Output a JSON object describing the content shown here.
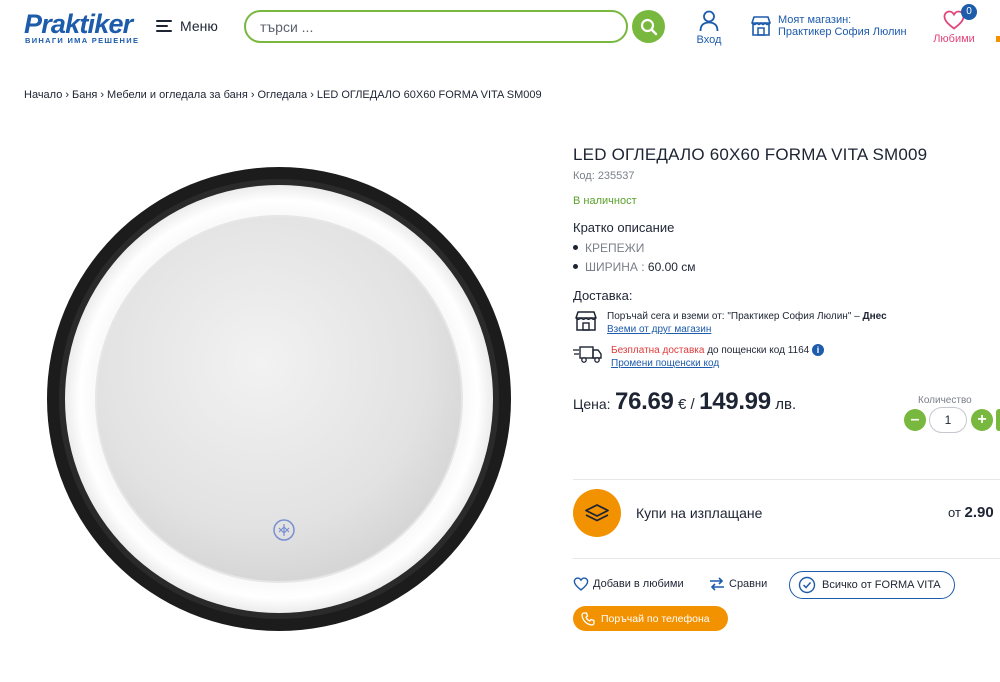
{
  "header": {
    "logo_text": "Praktiker",
    "logo_tagline": "ВИНАГИ ИМА РЕШЕНИЕ",
    "menu_label": "Меню",
    "search_placeholder": "търси ...",
    "login_label": "Вход",
    "store_label": "Моят магазин:",
    "store_name": "Практикер София Люлин",
    "favorites_label": "Любими",
    "favorites_count": "0"
  },
  "breadcrumb": [
    "Начало",
    "Баня",
    "Мебели и огледала за баня",
    "Огледала",
    "LED ОГЛЕДАЛО 60X60 FORMA VITA SM009"
  ],
  "product": {
    "title": "LED ОГЛЕДАЛО 60X60 FORMA VITA SM009",
    "sku": "Код: 235537",
    "stock": "В наличност",
    "short_description_title": "Кратко описание",
    "specs": [
      {
        "key": "КРЕПЕЖИ",
        "value": ""
      },
      {
        "key": "ШИРИНА :",
        "value": " 60.00 см"
      }
    ]
  },
  "delivery": {
    "title": "Доставка:",
    "pickup_text": "Поръчай сега и вземи от: \"Практикер София Люлин\" – ",
    "pickup_when": "Днес",
    "pickup_link": "Вземи от друг магазин",
    "free_label": "Безплатна доставка",
    "free_text": " до пощенски код 1164",
    "postcode_link": "Промени пощенски код"
  },
  "price": {
    "label": "Цена:",
    "eur": "76.69",
    "eur_sym": "€ /",
    "bgn": "149.99",
    "bgn_sym": "лв."
  },
  "quantity": {
    "label": "Количество",
    "value": "1",
    "minus": "–",
    "plus": "+"
  },
  "installment": {
    "label": "Купи на изплащане",
    "from_prefix": "от",
    "from_value": "2.90"
  },
  "actions": {
    "favorite": "Добави в любими",
    "compare": "Сравни",
    "brand": "Всичко от FORMA VITA",
    "phone_order": "Поръчай по телефона"
  },
  "colors": {
    "brand_blue": "#1d5bab",
    "accent_green": "#79b83e",
    "accent_orange": "#f39200",
    "favorite_pink": "#e0457b"
  }
}
